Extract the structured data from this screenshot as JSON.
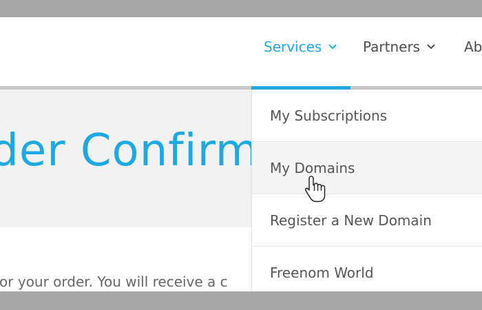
{
  "nav": {
    "items": [
      {
        "label": "Services",
        "active": true
      },
      {
        "label": "Partners",
        "active": false
      },
      {
        "label": "Ab",
        "active": false
      }
    ],
    "icons": {
      "dropdown": "chevron-down-icon"
    }
  },
  "hero": {
    "title": "rder Confirm"
  },
  "body": {
    "text": "for your order. You will receive a c"
  },
  "dropdown": {
    "items": [
      {
        "label": "My Subscriptions"
      },
      {
        "label": "My Domains",
        "hovered": true
      },
      {
        "label": "Register a New Domain"
      },
      {
        "label": "Freenom World"
      }
    ]
  },
  "colors": {
    "accent": "#1ea9e1",
    "text": "#555555",
    "hero_bg": "#f2f2f2",
    "frame": "#a8a8a8"
  },
  "cursor": {
    "icon": "hand-pointer-icon"
  }
}
